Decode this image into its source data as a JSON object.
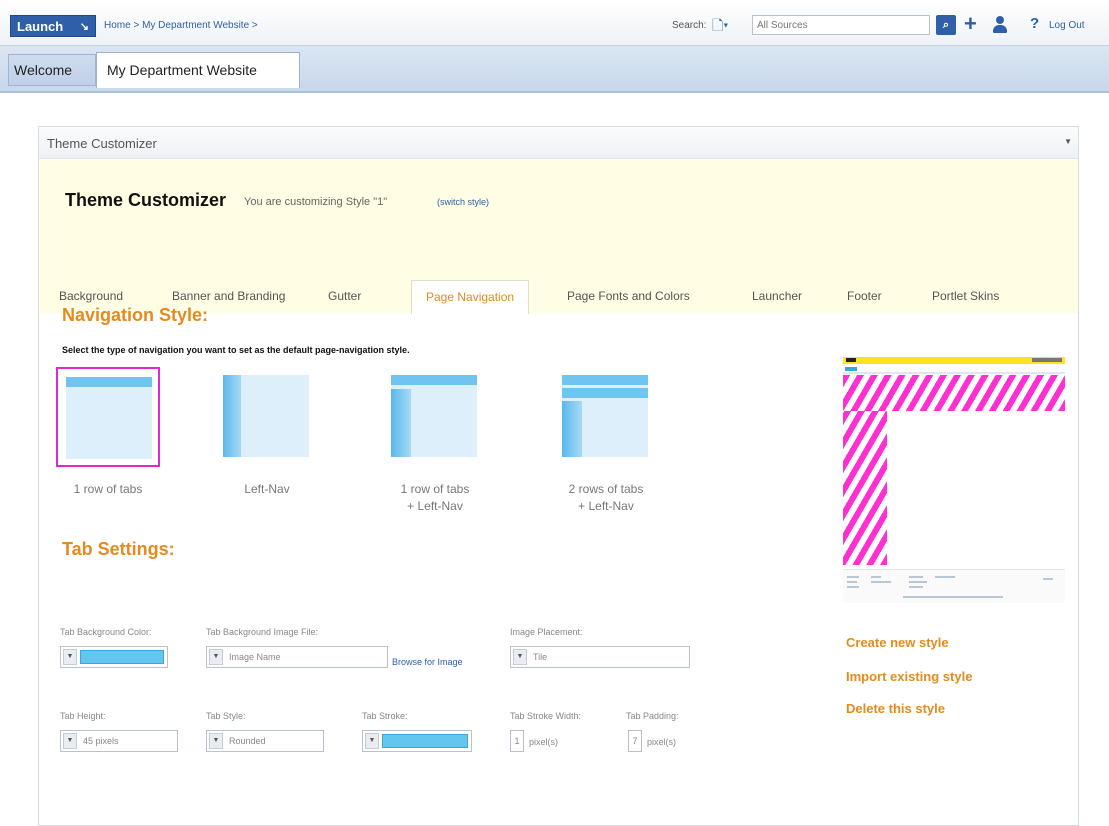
{
  "topbar": {
    "launch_label": "Launch",
    "breadcrumb": "Home > My Department Website >",
    "search_label": "Search:",
    "search_placeholder": "All Sources",
    "logout_label": "Log Out"
  },
  "tabs_top": {
    "welcome": "Welcome",
    "site": "My Department Website"
  },
  "portlet": {
    "title": "Theme Customizer"
  },
  "customizer": {
    "title": "Theme Customizer",
    "subtitle": "You are customizing Style \"1\"",
    "switch_link": "(switch style)",
    "tabs": [
      {
        "label": "Background"
      },
      {
        "label": "Banner and Branding"
      },
      {
        "label": "Gutter"
      },
      {
        "label": "Page Navigation"
      },
      {
        "label": "Page Fonts and Colors"
      },
      {
        "label": "Launcher"
      },
      {
        "label": "Footer"
      },
      {
        "label": "Portlet Skins"
      }
    ],
    "active_tab": "Page Navigation"
  },
  "navigation": {
    "heading": "Navigation Style:",
    "description": "Select the type of navigation you want to set as the default page-navigation style.",
    "options": [
      {
        "line1": "1 row of tabs",
        "line2": ""
      },
      {
        "line1": "Left-Nav",
        "line2": ""
      },
      {
        "line1": "1 row of tabs",
        "line2": "+ Left-Nav"
      },
      {
        "line1": "2 rows of tabs",
        "line2": "+ Left-Nav"
      }
    ],
    "selected_option": "1 row of tabs"
  },
  "tab_settings": {
    "heading": "Tab Settings:",
    "bg_color_label": "Tab Background Color:",
    "bg_color_value": "#62c6ee",
    "bg_image_label": "Tab Background Image File:",
    "bg_image_placeholder": "Image Name",
    "browse_label": "Browse for Image",
    "placement_label": "Image Placement:",
    "placement_value": "Tile",
    "height_label": "Tab Height:",
    "height_value": "45 pixels",
    "style_label": "Tab Style:",
    "style_value": "Rounded",
    "stroke_label": "Tab Stroke:",
    "stroke_value": "#62c6ee",
    "stroke_width_label": "Tab Stroke Width:",
    "stroke_width_value": "1",
    "stroke_width_unit": "pixel(s)",
    "padding_label": "Tab Padding:",
    "padding_value": "7",
    "padding_unit": "pixel(s)"
  },
  "side_links": {
    "create": "Create new style",
    "import": "Import existing style",
    "delete": "Delete this style"
  },
  "colors": {
    "accent_orange": "#e58a1c",
    "brand_blue": "#2f5fa8",
    "selection_magenta": "#e028cc"
  },
  "icons": [
    "launch-chevron-icon",
    "document-icon",
    "search-icon",
    "plus-icon",
    "user-icon",
    "help-icon",
    "dropdown-arrow-icon",
    "portlet-menu-icon"
  ]
}
